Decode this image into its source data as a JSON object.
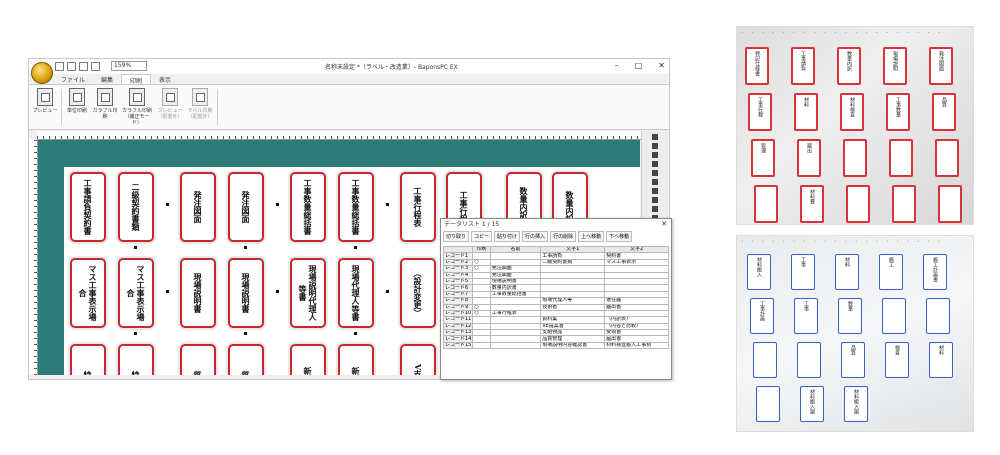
{
  "app": {
    "title": "名称未設定 *（ラベル・改造業）- BaponsPC EX",
    "zoom": "159%",
    "tabs": [
      "ファイル",
      "編集",
      "印刷",
      "表示"
    ],
    "active_tab": "印刷",
    "ribbon": [
      {
        "label": "プレビュー",
        "enabled": true
      },
      {
        "label": "単位印刷",
        "enabled": true
      },
      {
        "label": "カラフル印刷",
        "enabled": true
      },
      {
        "label": "カラフル印刷（補正モード）",
        "enabled": true
      },
      {
        "label": "プレビュー（配置外）",
        "enabled": false
      },
      {
        "label": "ラベル印刷（配置外）",
        "enabled": false
      }
    ],
    "window_controls": [
      "–",
      "□",
      "✕"
    ]
  },
  "cards": {
    "row1": [
      "工事請負契約書",
      "二級契約書類",
      "発注図面",
      "発注図面",
      "工事数量総括書",
      "工事数量総括書",
      "工事行程表",
      "工事行程",
      "数量内訳書",
      "数量内訳"
    ],
    "row2": [
      "マス工事表示場合",
      "マス工事表示場合",
      "現場説明書",
      "現場説明書",
      "現場説明代理人等書",
      "現場代理人等書",
      "（設計変更）",
      "",
      ""
    ],
    "row3": [
      "特記",
      "特記",
      "質問",
      "質問",
      "新内容",
      "新内容",
      "V支給品"
    ]
  },
  "dialog": {
    "title": "データリスト 1 / 15",
    "toolbar": [
      "切り取り",
      "コピー",
      "貼り付け",
      "行の挿入",
      "行の削除",
      "上へ移動",
      "下へ移動"
    ],
    "columns": [
      "",
      "印刷",
      "名前",
      "文字1",
      "文字2"
    ],
    "rows": [
      [
        "レコード1",
        "",
        "",
        "工事請負",
        "契約書"
      ],
      [
        "レコード2",
        "○",
        "",
        "二級契約書類",
        "マス工事表示"
      ],
      [
        "レコード3",
        "○",
        "発注図面",
        "",
        ""
      ],
      [
        "レコード4",
        "",
        "発注図面",
        "",
        ""
      ],
      [
        "レコード5",
        "",
        "現場説明書",
        "",
        ""
      ],
      [
        "レコード6",
        "",
        "数量内訳書",
        "",
        ""
      ],
      [
        "レコード7",
        "",
        "工事数量総括書",
        "",
        ""
      ],
      [
        "レコード8",
        "",
        "",
        "現場代理人等",
        "選任届"
      ],
      [
        "レコード9",
        "○",
        "",
        "技術者",
        "届出書"
      ],
      [
        "レコード10",
        "○",
        "工事行程表",
        "",
        ""
      ],
      [
        "レコード11",
        "",
        "",
        "資料集",
        "（内訳表）"
      ],
      [
        "レコード12",
        "",
        "",
        "VE提案書",
        "（内容と比較）"
      ],
      [
        "レコード13",
        "",
        "",
        "支給物品",
        "受領書"
      ],
      [
        "レコード14",
        "",
        "",
        "品質管理",
        "届出書"
      ],
      [
        "レコード15",
        "",
        "",
        "現場説明内容確認書",
        "材料検査搬入工事別"
      ]
    ]
  },
  "photo_red": [
    "特記仕様書",
    "工事請負",
    "数量内訳",
    "現場説明",
    "発注図面",
    "工事行程",
    "材料",
    "材料検査",
    "工事数量",
    "品質",
    "管理",
    "届出",
    "",
    "",
    "",
    "",
    "材料費",
    "",
    "",
    ""
  ],
  "photo_blue": [
    "材料搬入",
    "工事",
    "材料",
    "施工",
    "施工計画書",
    "工事計画",
    "工事",
    "数量",
    "",
    "",
    "",
    "",
    "品質",
    "検査",
    "材料",
    "",
    "材料搬入届",
    "材料搬入届"
  ],
  "colors": {
    "band": "#2d7c78",
    "card_border": "#c8282b",
    "blue_label": "#3a62c2",
    "red_label": "#d8323a"
  }
}
